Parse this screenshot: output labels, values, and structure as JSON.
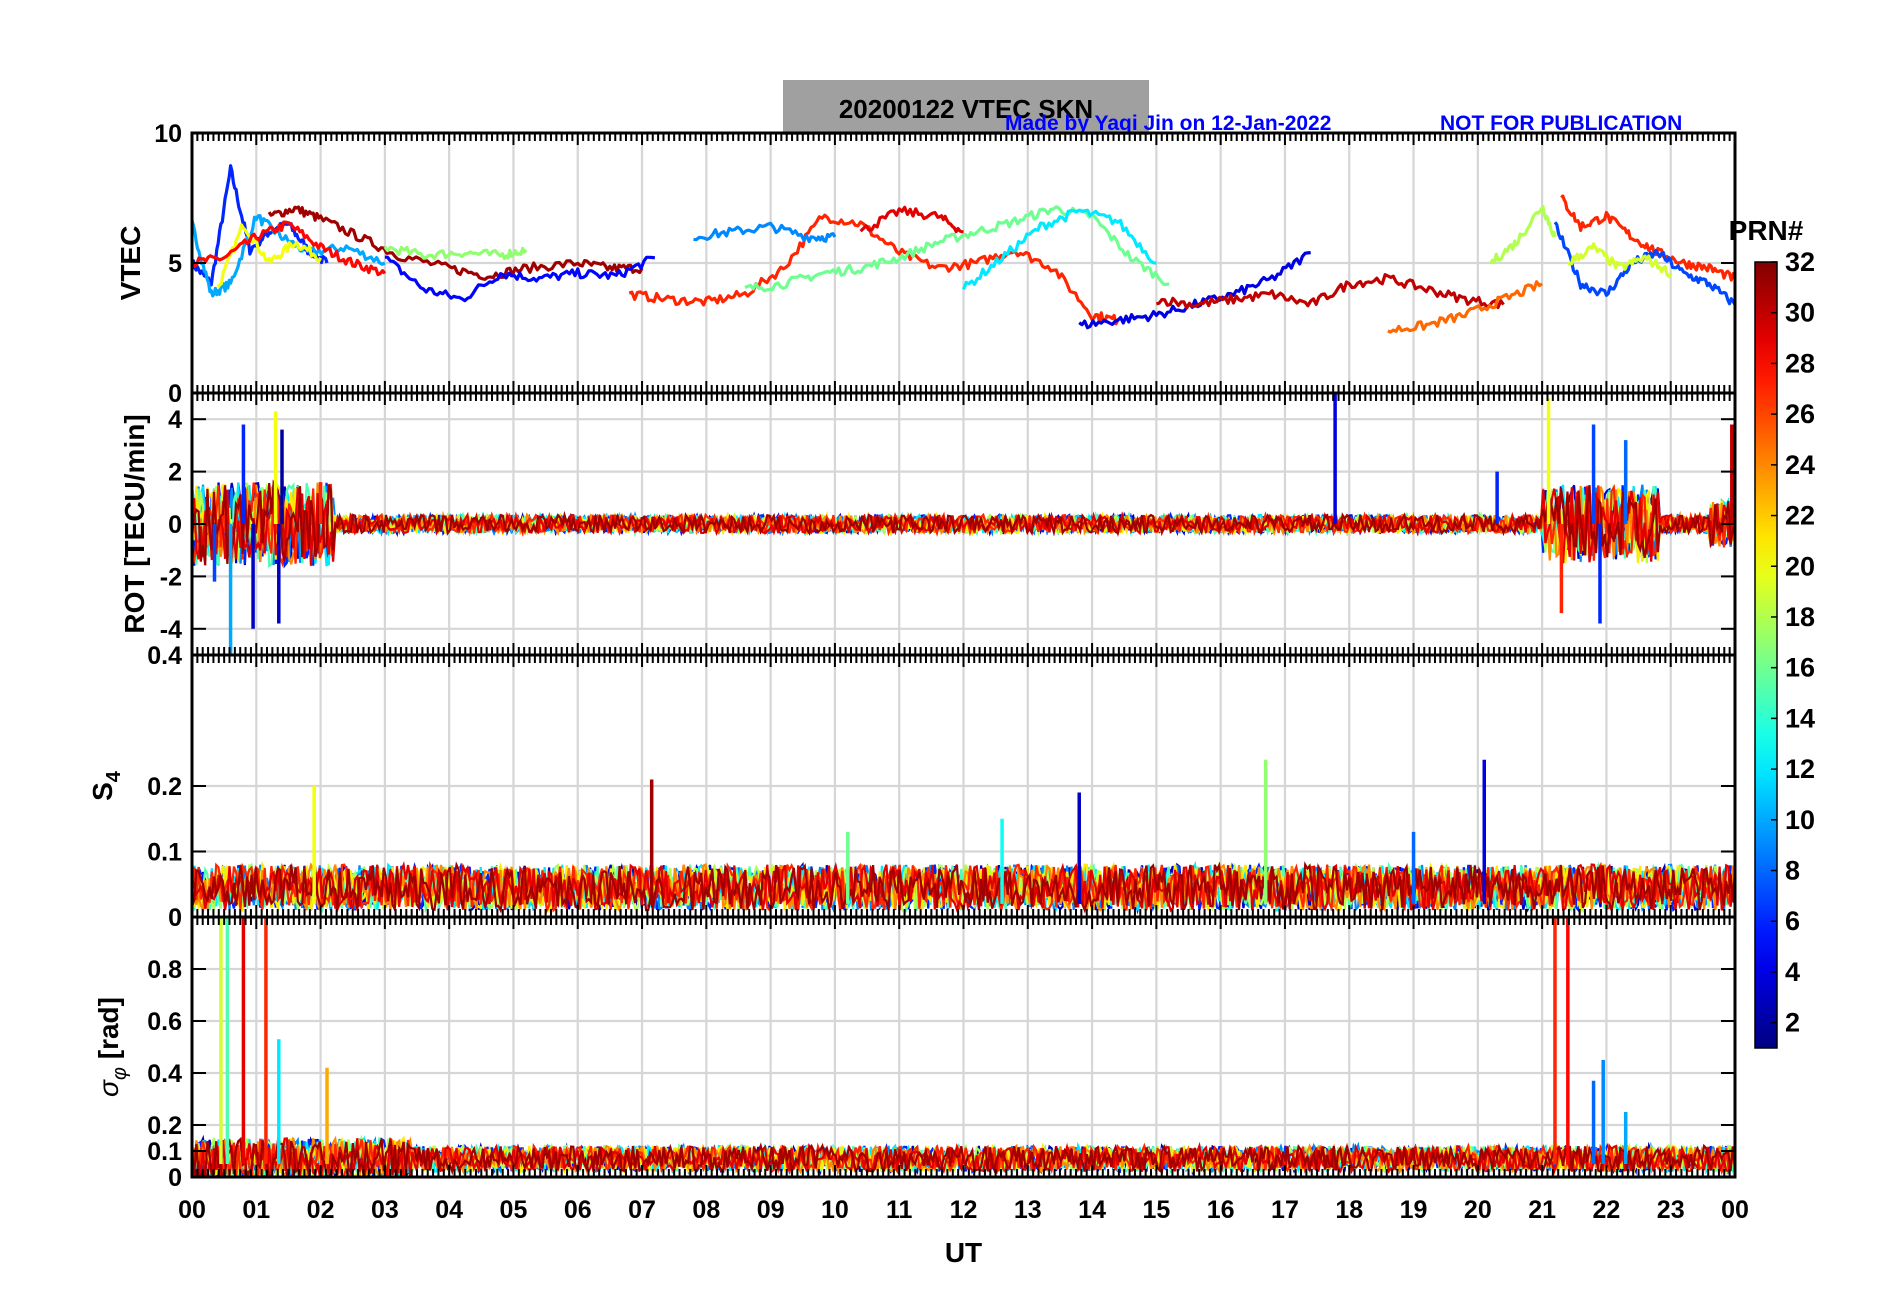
{
  "header": {
    "title": "20200122    VTEC  SKN",
    "credit": "Made by Yaqi Jin on 12-Jan-2022",
    "notice": "NOT FOR PUBLICATION",
    "title_bg": "#a0a0a0",
    "credit_color": "#0000ff"
  },
  "colorbar": {
    "label": "PRN#",
    "range": [
      1,
      32
    ],
    "ticks": [
      "2",
      "4",
      "6",
      "8",
      "10",
      "12",
      "14",
      "16",
      "18",
      "20",
      "22",
      "24",
      "26",
      "28",
      "30",
      "32"
    ],
    "colormap": "jet"
  },
  "chart_data": [
    {
      "type": "line",
      "ylabel": "VTEC",
      "ylim": [
        0,
        10
      ],
      "yticks": [
        "0",
        "5",
        "10"
      ],
      "grid": true,
      "series": [
        {
          "prn": 6,
          "x": [
            0,
            0.3,
            0.6,
            0.9,
            1.2,
            1.5,
            1.8,
            2.1
          ],
          "y": [
            5,
            4.2,
            8.6,
            5.5,
            6.2,
            6.5,
            5.5,
            5.0
          ]
        },
        {
          "prn": 10,
          "x": [
            0,
            0.3,
            0.6,
            1.0,
            1.4,
            1.8,
            2.4,
            3.0
          ],
          "y": [
            6.5,
            3.8,
            4.2,
            6.8,
            6.0,
            5.4,
            5.6,
            5.0
          ]
        },
        {
          "prn": 20,
          "x": [
            0.4,
            0.8,
            1.2,
            1.6,
            2.0
          ],
          "y": [
            4.0,
            6.5,
            5.0,
            5.8,
            5.2
          ]
        },
        {
          "prn": 28,
          "x": [
            0,
            0.5,
            1.0,
            1.5,
            2.0,
            2.5,
            3.0
          ],
          "y": [
            5,
            5.2,
            6.0,
            6.5,
            5.6,
            5.0,
            4.6
          ]
        },
        {
          "prn": 31,
          "x": [
            1.2,
            1.6,
            2.0,
            2.6,
            3.2,
            4.0,
            4.6,
            5.2,
            6.0,
            6.5,
            7.0
          ],
          "y": [
            6.8,
            7.1,
            6.7,
            6.0,
            5.3,
            4.8,
            4.5,
            4.8,
            5.0,
            4.8,
            4.8
          ]
        },
        {
          "prn": 5,
          "x": [
            3.0,
            3.6,
            4.2,
            4.8,
            5.4,
            6.0,
            6.6,
            7.2
          ],
          "y": [
            5.2,
            4.0,
            3.6,
            4.6,
            4.4,
            4.6,
            4.5,
            5.2
          ]
        },
        {
          "prn": 17,
          "x": [
            3.0,
            3.6,
            4.2,
            4.8,
            5.2
          ],
          "y": [
            5.6,
            5.3,
            5.4,
            5.3,
            5.5
          ]
        },
        {
          "prn": 27,
          "x": [
            6.8,
            7.4,
            8.0,
            8.6,
            9.2,
            9.8,
            10.4,
            11.0,
            11.6,
            12.2,
            12.8,
            13.4,
            14.0,
            14.4
          ],
          "y": [
            3.8,
            3.6,
            3.5,
            3.8,
            4.8,
            6.8,
            6.5,
            5.4,
            4.8,
            5.0,
            5.5,
            4.8,
            3.0,
            2.8
          ]
        },
        {
          "prn": 9,
          "x": [
            7.8,
            8.4,
            9.0,
            9.6,
            10.0
          ],
          "y": [
            6.0,
            6.2,
            6.4,
            6.0,
            6.0
          ]
        },
        {
          "prn": 16,
          "x": [
            8.6,
            9.2,
            9.8,
            10.4,
            11.0,
            11.6,
            12.2,
            12.8,
            13.4,
            14.0,
            14.6,
            15.2
          ],
          "y": [
            4.0,
            4.2,
            4.6,
            4.8,
            5.2,
            5.8,
            6.2,
            6.6,
            7.1,
            6.8,
            5.2,
            4.2
          ]
        },
        {
          "prn": 12,
          "x": [
            12.0,
            12.6,
            13.2,
            13.8,
            14.4,
            15.0
          ],
          "y": [
            4.0,
            5.2,
            6.4,
            7.0,
            6.6,
            5.0
          ]
        },
        {
          "prn": 29,
          "x": [
            10.4,
            11.0,
            11.6,
            12.0
          ],
          "y": [
            6.2,
            7.0,
            6.8,
            6.2
          ]
        },
        {
          "prn": 4,
          "x": [
            13.8,
            14.4,
            15.0,
            15.6,
            16.2,
            16.8,
            17.4
          ],
          "y": [
            2.6,
            2.8,
            3.0,
            3.4,
            3.8,
            4.4,
            5.4
          ]
        },
        {
          "prn": 30,
          "x": [
            15.0,
            15.6,
            16.2,
            16.8,
            17.4,
            18.0,
            18.6,
            19.2,
            19.8,
            20.4
          ],
          "y": [
            3.6,
            3.4,
            3.6,
            3.8,
            3.4,
            4.2,
            4.4,
            4.0,
            3.6,
            3.4
          ]
        },
        {
          "prn": 25,
          "x": [
            18.6,
            19.2,
            19.8,
            20.4,
            21.0
          ],
          "y": [
            2.4,
            2.6,
            3.0,
            3.6,
            4.2
          ]
        },
        {
          "prn": 18,
          "x": [
            20.2,
            20.6,
            21.0,
            21.2
          ],
          "y": [
            5.0,
            5.8,
            7.2,
            6.0
          ]
        },
        {
          "prn": 27,
          "x": [
            21.3,
            21.6,
            22.0,
            22.4,
            22.8,
            23.2,
            23.6,
            24.0
          ],
          "y": [
            7.5,
            6.4,
            6.8,
            6.0,
            5.4,
            5.0,
            4.8,
            4.4
          ]
        },
        {
          "prn": 7,
          "x": [
            21.2,
            21.6,
            22.0,
            22.4,
            22.8,
            23.2,
            23.6,
            24.0
          ],
          "y": [
            6.5,
            4.2,
            3.8,
            5.0,
            5.4,
            4.6,
            4.2,
            3.4
          ]
        },
        {
          "prn": 19,
          "x": [
            21.4,
            21.8,
            22.2,
            22.6,
            23.0
          ],
          "y": [
            5.0,
            5.6,
            4.8,
            5.2,
            4.6
          ]
        }
      ]
    },
    {
      "type": "line",
      "ylabel": "ROT [TECU/min]",
      "ylim": [
        -5,
        5
      ],
      "yticks": [
        "-4",
        "-2",
        "0",
        "2",
        "4"
      ],
      "grid": true,
      "spikes": [
        {
          "prn": 7,
          "x": 0.35,
          "y": -2.2
        },
        {
          "prn": 10,
          "x": 0.6,
          "y": -5.0
        },
        {
          "prn": 6,
          "x": 0.8,
          "y": 3.8
        },
        {
          "prn": 3,
          "x": 0.95,
          "y": -4.0
        },
        {
          "prn": 20,
          "x": 1.3,
          "y": 4.3
        },
        {
          "prn": 2,
          "x": 1.4,
          "y": 3.6
        },
        {
          "prn": 3,
          "x": 1.35,
          "y": -3.8
        },
        {
          "prn": 27,
          "x": 2.0,
          "y": 1.6
        },
        {
          "prn": 4,
          "x": 17.78,
          "y": 5.0
        },
        {
          "prn": 6,
          "x": 20.3,
          "y": 2.0
        },
        {
          "prn": 20,
          "x": 21.1,
          "y": 4.8
        },
        {
          "prn": 27,
          "x": 21.3,
          "y": -3.4
        },
        {
          "prn": 7,
          "x": 21.8,
          "y": 3.8
        },
        {
          "prn": 6,
          "x": 21.9,
          "y": -3.8
        },
        {
          "prn": 8,
          "x": 22.3,
          "y": 3.2
        },
        {
          "prn": 30,
          "x": 23.95,
          "y": 3.8
        }
      ]
    },
    {
      "type": "line",
      "ylabel": "S4",
      "ylim": [
        0,
        0.4
      ],
      "yticks": [
        "0",
        "0.1",
        "0.2",
        "0.4"
      ],
      "grid": true,
      "spikes": [
        {
          "prn": 20,
          "x": 1.9,
          "y": 0.2
        },
        {
          "prn": 31,
          "x": 7.15,
          "y": 0.21
        },
        {
          "prn": 13,
          "x": 12.6,
          "y": 0.15
        },
        {
          "prn": 3,
          "x": 13.8,
          "y": 0.19
        },
        {
          "prn": 17,
          "x": 16.7,
          "y": 0.24
        },
        {
          "prn": 4,
          "x": 20.1,
          "y": 0.24
        },
        {
          "prn": 8,
          "x": 19.0,
          "y": 0.13
        },
        {
          "prn": 16,
          "x": 10.2,
          "y": 0.13
        }
      ]
    },
    {
      "type": "line",
      "ylabel": "σφ [rad]",
      "ylim": [
        0,
        1
      ],
      "yticks": [
        "0",
        "0.1",
        "0.2",
        "0.4",
        "0.6",
        "0.8"
      ],
      "grid": true,
      "spikes": [
        {
          "prn": 19,
          "x": 0.45,
          "y": 1.0
        },
        {
          "prn": 15,
          "x": 0.55,
          "y": 1.0
        },
        {
          "prn": 29,
          "x": 0.8,
          "y": 1.0
        },
        {
          "prn": 27,
          "x": 1.15,
          "y": 1.0
        },
        {
          "prn": 12,
          "x": 1.35,
          "y": 0.53
        },
        {
          "prn": 23,
          "x": 2.1,
          "y": 0.42
        },
        {
          "prn": 27,
          "x": 21.2,
          "y": 1.0
        },
        {
          "prn": 28,
          "x": 21.4,
          "y": 1.0
        },
        {
          "prn": 9,
          "x": 21.95,
          "y": 0.45
        },
        {
          "prn": 8,
          "x": 21.8,
          "y": 0.37
        },
        {
          "prn": 10,
          "x": 22.3,
          "y": 0.25
        }
      ]
    }
  ],
  "xaxis": {
    "label": "UT",
    "range": [
      0,
      24
    ],
    "ticks": [
      "00",
      "01",
      "02",
      "03",
      "04",
      "05",
      "06",
      "07",
      "08",
      "09",
      "10",
      "11",
      "12",
      "13",
      "14",
      "15",
      "16",
      "17",
      "18",
      "19",
      "20",
      "21",
      "22",
      "23",
      "00"
    ]
  }
}
